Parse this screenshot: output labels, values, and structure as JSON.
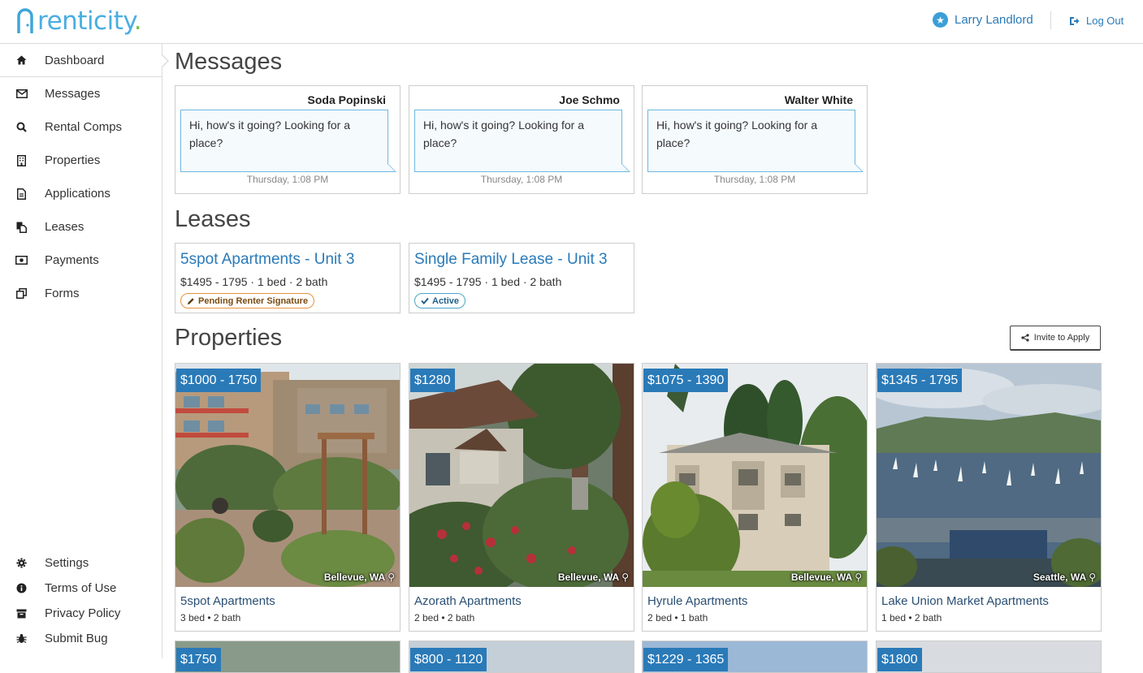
{
  "brand": {
    "name": "renticity",
    "accent": "#3b9fd8"
  },
  "header": {
    "user_name": "Larry Landlord",
    "logout_label": "Log Out"
  },
  "sidebar": {
    "items": [
      {
        "label": "Dashboard",
        "icon": "home-icon"
      },
      {
        "label": "Messages",
        "icon": "envelope-icon"
      },
      {
        "label": "Rental Comps",
        "icon": "search-icon"
      },
      {
        "label": "Properties",
        "icon": "building-icon"
      },
      {
        "label": "Applications",
        "icon": "document-icon"
      },
      {
        "label": "Leases",
        "icon": "files-icon"
      },
      {
        "label": "Payments",
        "icon": "money-icon"
      },
      {
        "label": "Forms",
        "icon": "copy-icon"
      }
    ],
    "bottom_items": [
      {
        "label": "Settings",
        "icon": "gear-icon"
      },
      {
        "label": "Terms of Use",
        "icon": "info-icon"
      },
      {
        "label": "Privacy Policy",
        "icon": "archive-icon"
      },
      {
        "label": "Submit Bug",
        "icon": "bug-icon"
      }
    ]
  },
  "messages": {
    "title": "Messages",
    "items": [
      {
        "name": "Soda Popinski",
        "text": "Hi, how's it going? Looking for a place?",
        "time": "Thursday, 1:08 PM"
      },
      {
        "name": "Joe Schmo",
        "text": "Hi, how's it going? Looking for a place?",
        "time": "Thursday, 1:08 PM"
      },
      {
        "name": "Walter White",
        "text": "Hi, how's it going? Looking for a place?",
        "time": "Thursday, 1:08 PM"
      }
    ]
  },
  "leases": {
    "title": "Leases",
    "items": [
      {
        "title": "5spot Apartments - Unit 3",
        "info": "$1495 - 1795 · 1 bed · 2 bath",
        "status": "Pending Renter Signature"
      },
      {
        "title": "Single Family Lease - Unit 3",
        "info": "$1495 - 1795 · 1 bed · 2 bath",
        "status": "Active"
      }
    ]
  },
  "properties": {
    "title": "Properties",
    "invite_label": "Invite to Apply",
    "items": [
      {
        "price": "$1000 - 1750",
        "location": "Bellevue, WA",
        "name": "5spot Apartments",
        "info": "3 bed • 2 bath"
      },
      {
        "price": "$1280",
        "location": "Bellevue, WA",
        "name": "Azorath Apartments",
        "info": "2 bed • 2 bath"
      },
      {
        "price": "$1075 - 1390",
        "location": "Bellevue, WA",
        "name": "Hyrule Apartments",
        "info": "2 bed • 1 bath"
      },
      {
        "price": "$1345 - 1795",
        "location": "Seattle, WA",
        "name": "Lake Union Market Apartments",
        "info": "1 bed • 2 bath"
      }
    ],
    "row2_prices": [
      "$1750",
      "$800 - 1120",
      "$1229 - 1365",
      "$1800"
    ]
  }
}
